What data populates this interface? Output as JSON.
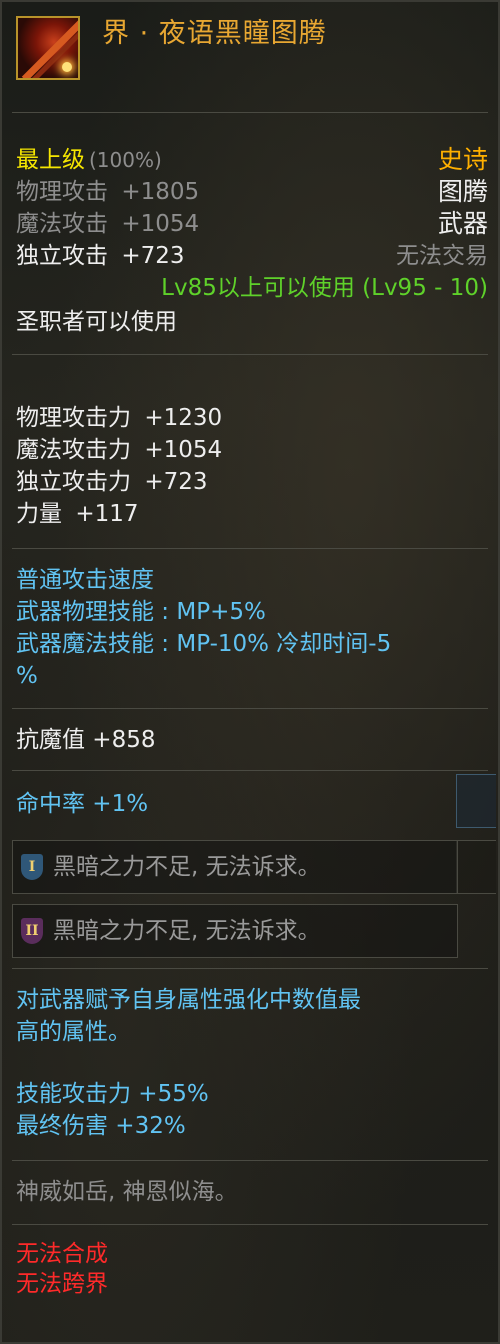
{
  "item": {
    "name": "界 · 夜语黑瞳图腾",
    "icon": "spear-weapon-icon"
  },
  "header": {
    "grade": "最上级",
    "grade_pct": "(100%)",
    "rarity": "史诗",
    "type1": "图腾",
    "type2": "武器",
    "trade": "无法交易",
    "level_req": "Lv85以上可以使用 (Lv95 - 10)",
    "class_req": "圣职者可以使用",
    "stats": [
      {
        "name": "物理攻击",
        "value": "+1805"
      },
      {
        "name": "魔法攻击",
        "value": "+1054"
      },
      {
        "name": "独立攻击",
        "value": "+723"
      }
    ]
  },
  "attributes": [
    {
      "name": "物理攻击力",
      "value": "+1230"
    },
    {
      "name": "魔法攻击力",
      "value": "+1054"
    },
    {
      "name": "独立攻击力",
      "value": "+723"
    },
    {
      "name": "力量",
      "value": "+117"
    }
  ],
  "speed": {
    "line1": "普通攻击速度",
    "line2": "武器物理技能 :  MP+5%",
    "line3": "武器魔法技能 :  MP-10% 冷却时间-5",
    "line4": "%"
  },
  "anti_magic": "抗魔值 +858",
  "hit_rate": "命中率 +1%",
  "slots": [
    {
      "badge": "I",
      "text": "黑暗之力不足, 无法诉求。"
    },
    {
      "badge": "II",
      "text": "黑暗之力不足, 无法诉求。"
    }
  ],
  "effect": {
    "line1": "对武器赋予自身属性强化中数值最",
    "line2": "高的属性。",
    "skill_atk": "技能攻击力 +55%",
    "final_dmg": "最终伤害 +32%"
  },
  "flavor": "神威如岳, 神恩似海。",
  "restrictions": [
    "无法合成",
    "无法跨界"
  ],
  "colors": {
    "title": "#e8a732",
    "rarity": "#ffb000",
    "grade": "#f5e600",
    "white": "#eeeeee",
    "gray": "#8e8e8e",
    "green": "#5fd22a",
    "cyan": "#61c3f2",
    "red": "#ff2a2a"
  }
}
